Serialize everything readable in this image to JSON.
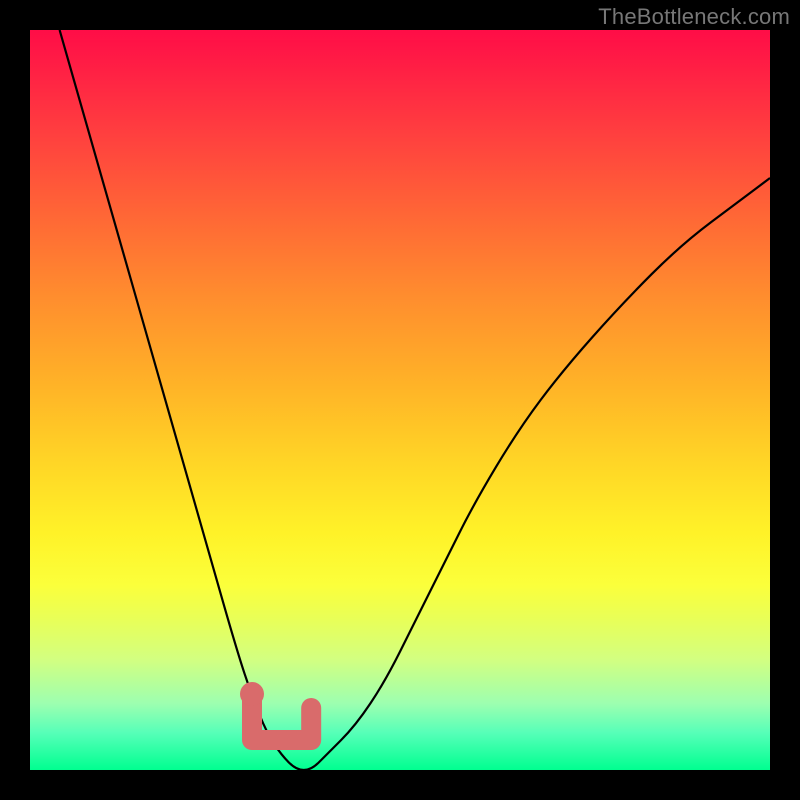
{
  "watermark": "TheBottleneck.com",
  "chart_data": {
    "type": "line",
    "title": "",
    "xlabel": "",
    "ylabel": "",
    "xlim": [
      0,
      100
    ],
    "ylim": [
      0,
      100
    ],
    "grid": false,
    "legend": false,
    "series": [
      {
        "name": "bottleneck-curve",
        "x": [
          4,
          8,
          12,
          16,
          20,
          24,
          28,
          30,
          32,
          34,
          36,
          38,
          40,
          44,
          48,
          52,
          56,
          60,
          66,
          72,
          80,
          88,
          96,
          100
        ],
        "y": [
          100,
          86,
          72,
          58,
          44,
          30,
          16,
          10,
          5,
          2,
          0,
          0,
          2,
          6,
          12,
          20,
          28,
          36,
          46,
          54,
          63,
          71,
          77,
          80
        ]
      }
    ],
    "highlight_region": {
      "x_start": 30,
      "x_end": 38,
      "description": "near-zero bottleneck region marker"
    },
    "background_gradient": {
      "orientation": "vertical",
      "stops": [
        {
          "pos": 0,
          "color": "#ff0d47"
        },
        {
          "pos": 26,
          "color": "#ff6a35"
        },
        {
          "pos": 58,
          "color": "#ffd426"
        },
        {
          "pos": 80,
          "color": "#e7ff5a"
        },
        {
          "pos": 100,
          "color": "#00ff90"
        }
      ]
    }
  }
}
